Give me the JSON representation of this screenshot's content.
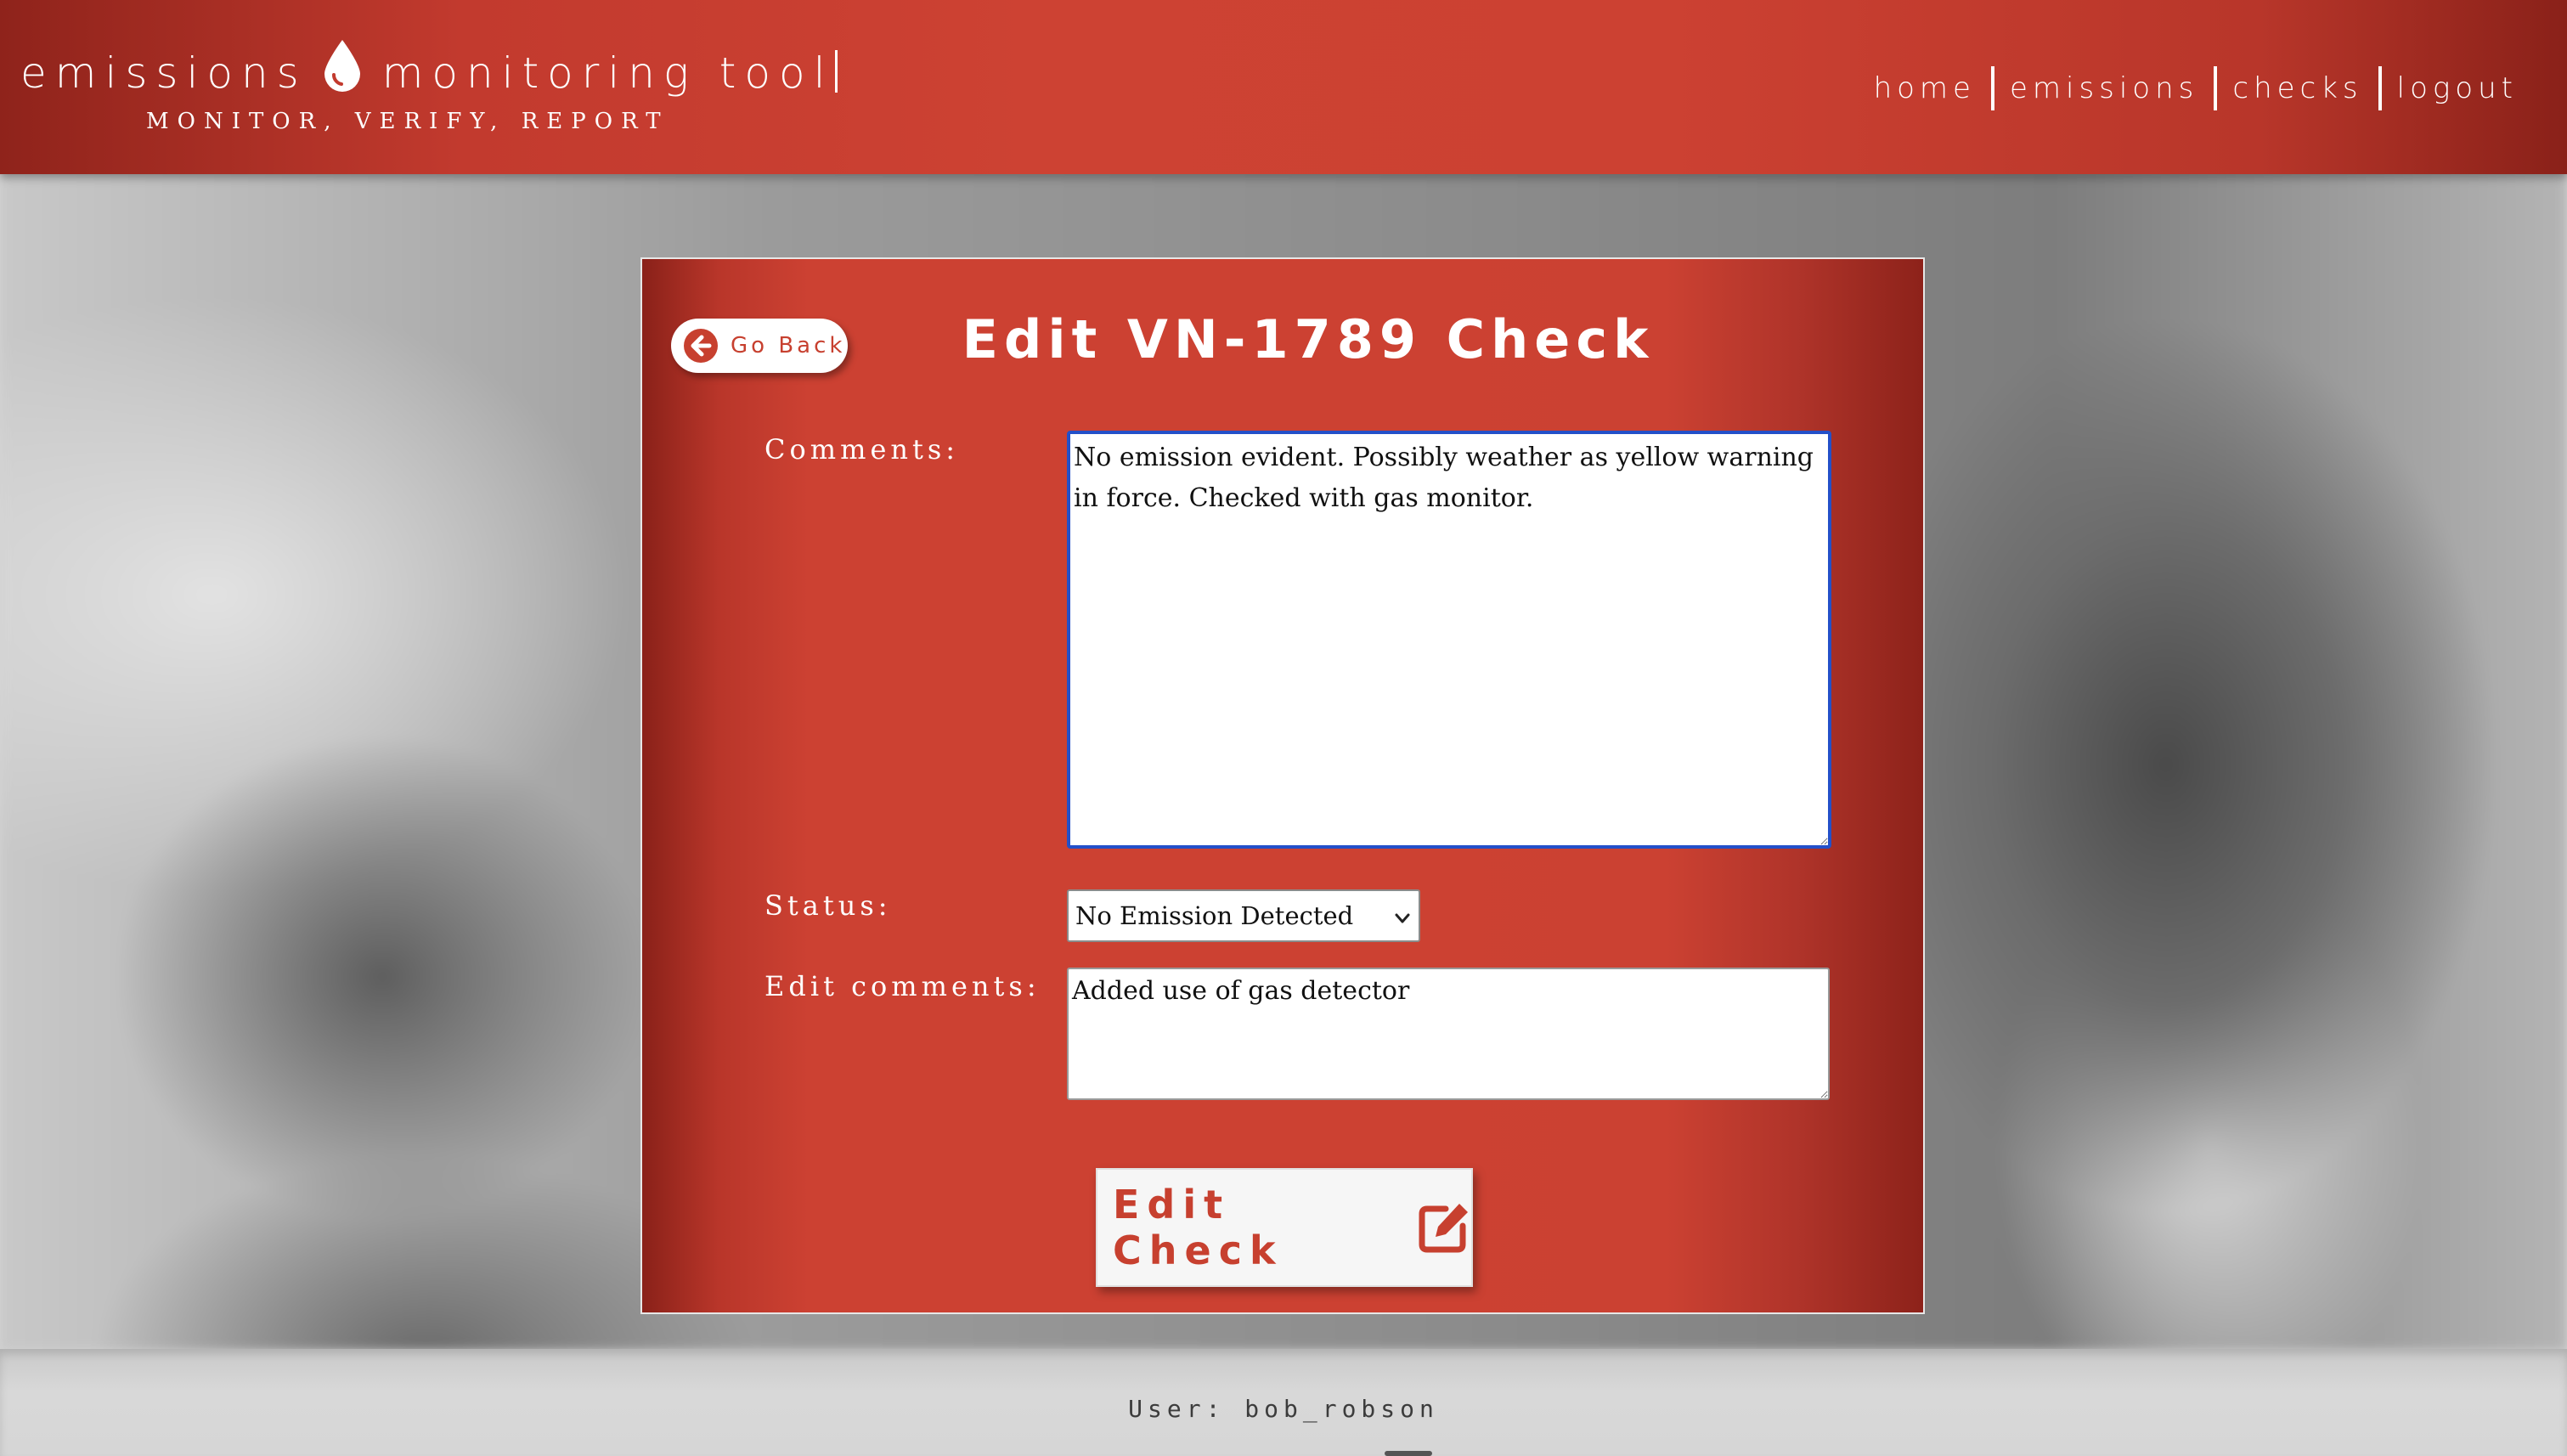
{
  "header": {
    "brand_left": "emissions",
    "brand_right": "monitoring tool",
    "tagline": "MONITOR, VERIFY, REPORT",
    "nav": [
      "home",
      "emissions",
      "checks",
      "logout"
    ]
  },
  "card": {
    "back_label": "Go Back",
    "title": "Edit VN-1789 Check",
    "comments_label": "Comments:",
    "comments_value": "No emission evident. Possibly weather as yellow warning in force. Checked with gas monitor.",
    "status_label": "Status:",
    "status_value": "No Emission Detected",
    "edit_comments_label": "Edit comments:",
    "edit_comments_value": "Added use of gas detector",
    "submit_label": "Edit Check"
  },
  "footer": {
    "user_text": "User: bob_robson"
  },
  "colors": {
    "accent": "#cc4132",
    "focus_border": "#2350c9"
  },
  "icons": {
    "brand": "water-drop-icon",
    "back": "arrow-circle-left-icon",
    "submit": "edit-pencil-square-icon"
  }
}
